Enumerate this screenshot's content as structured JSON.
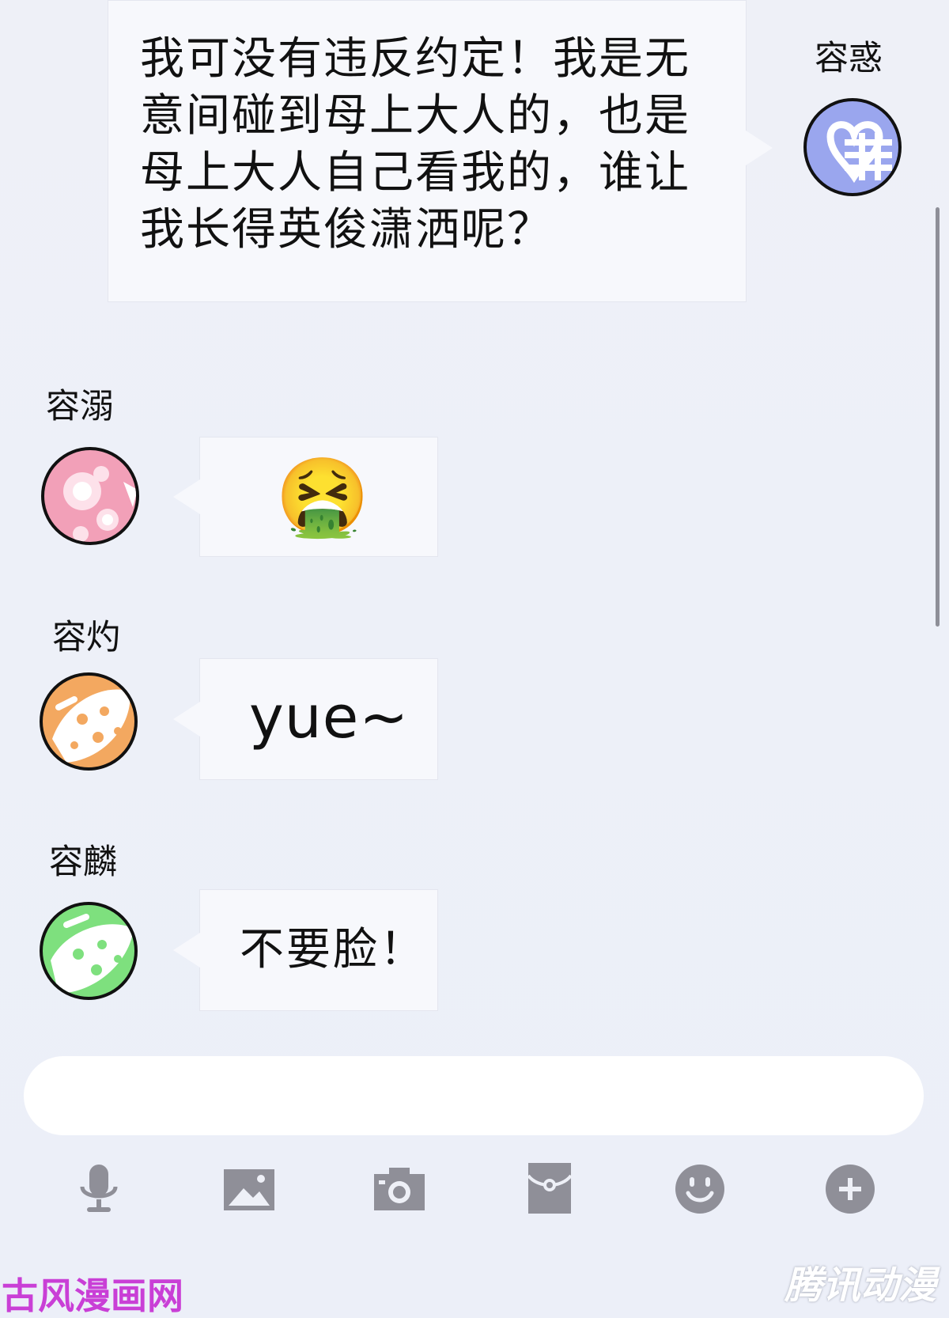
{
  "messages": [
    {
      "sender": "容惑",
      "text_lines": [
        "我可没有违反约定！我是无",
        "意间碰到母上大人的，也是",
        "母上大人自己看我的，谁让",
        "我长得英俊潇洒呢？"
      ],
      "side": "right",
      "avatar_color": "#9aa6ee"
    },
    {
      "sender": "容溺",
      "emoji": "🤮",
      "side": "left",
      "avatar_color": "#f2a0b8"
    },
    {
      "sender": "容灼",
      "text": "yue~",
      "side": "left",
      "avatar_color": "#f3a860"
    },
    {
      "sender": "容麟",
      "text": "不要脸！",
      "side": "left",
      "avatar_color": "#7ee07e"
    }
  ],
  "input": {
    "placeholder": ""
  },
  "toolbar": [
    {
      "icon": "microphone-icon"
    },
    {
      "icon": "image-icon"
    },
    {
      "icon": "camera-icon"
    },
    {
      "icon": "red-packet-icon"
    },
    {
      "icon": "emoji-icon"
    },
    {
      "icon": "plus-icon"
    }
  ],
  "colors": {
    "icon_gray": "#8f8f98",
    "bubble": "#f7f8fc",
    "background": "#edf0f8"
  },
  "watermarks": {
    "left": "古风漫画网",
    "right": "腾讯动漫"
  }
}
